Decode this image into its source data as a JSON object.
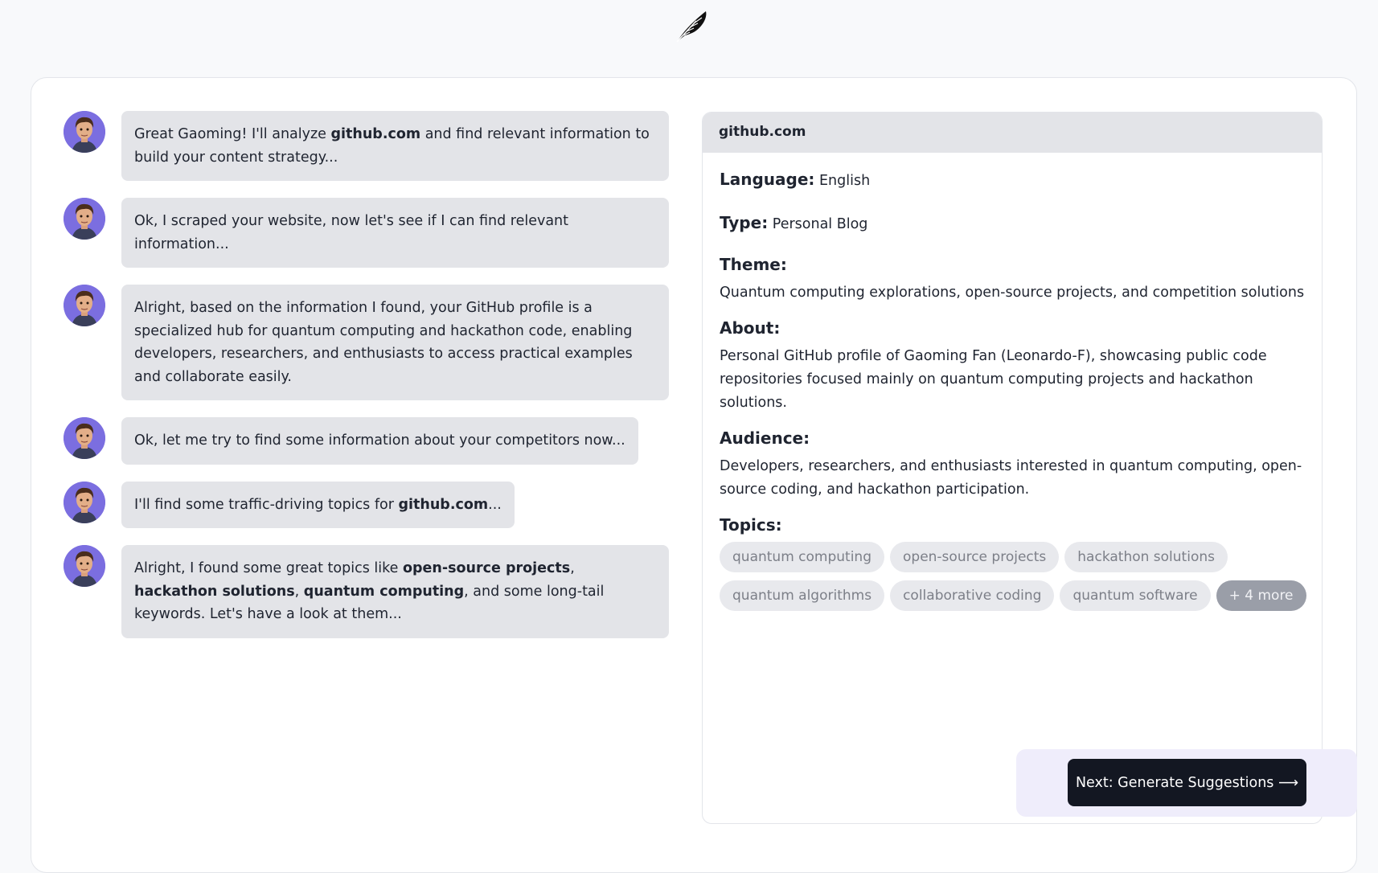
{
  "header": {
    "logo_icon": "feather-icon"
  },
  "chat": {
    "messages": [
      {
        "parts": [
          {
            "t": "Great Gaoming! I'll analyze ",
            "b": false
          },
          {
            "t": "github.com",
            "b": true
          },
          {
            "t": " and find relevant information to build your content strategy...",
            "b": false
          }
        ]
      },
      {
        "parts": [
          {
            "t": "Ok, I scraped your website, now let's see if I can find relevant information...",
            "b": false
          }
        ]
      },
      {
        "parts": [
          {
            "t": "Alright, based on the information I found, your GitHub profile is a specialized hub for quantum computing and hackathon code, enabling developers, researchers, and enthusiasts to access practical examples and collaborate easily.",
            "b": false
          }
        ]
      },
      {
        "parts": [
          {
            "t": "Ok, let me try to find some information about your competitors now...",
            "b": false
          }
        ]
      },
      {
        "parts": [
          {
            "t": "I'll find some traffic-driving topics for ",
            "b": false
          },
          {
            "t": "github.com",
            "b": true
          },
          {
            "t": "...",
            "b": false
          }
        ]
      },
      {
        "parts": [
          {
            "t": "Alright, I found some great topics like ",
            "b": false
          },
          {
            "t": "open-source projects",
            "b": true
          },
          {
            "t": ", ",
            "b": false
          },
          {
            "t": "hackathon solutions",
            "b": true
          },
          {
            "t": ", ",
            "b": false
          },
          {
            "t": "quantum computing",
            "b": true
          },
          {
            "t": ", and some long-tail keywords. Let's have a look at them...",
            "b": false
          }
        ]
      }
    ]
  },
  "panel": {
    "site": "github.com",
    "language_label": "Language:",
    "language": "English",
    "type_label": "Type:",
    "type": "Personal Blog",
    "theme_label": "Theme:",
    "theme": "Quantum computing explorations, open-source projects, and competition solutions",
    "about_label": "About:",
    "about": "Personal GitHub profile of Gaoming Fan (Leonardo-F), showcasing public code repositories focused mainly on quantum computing projects and hackathon solutions.",
    "audience_label": "Audience:",
    "audience": "Developers, researchers, and enthusiasts interested in quantum computing, open-source coding, and hackathon participation.",
    "topics_label": "Topics:",
    "topics": [
      "quantum computing",
      "open-source projects",
      "hackathon solutions",
      "quantum algorithms",
      "collaborative coding",
      "quantum software"
    ],
    "more_label": "+ 4 more"
  },
  "footer": {
    "next_label": "Next: Generate Suggestions ⟶"
  },
  "colors": {
    "accent_dark": "#131722",
    "bubble": "#e3e4e8",
    "avatar_bg": "#7b6ee0",
    "band": "#efedfb"
  }
}
